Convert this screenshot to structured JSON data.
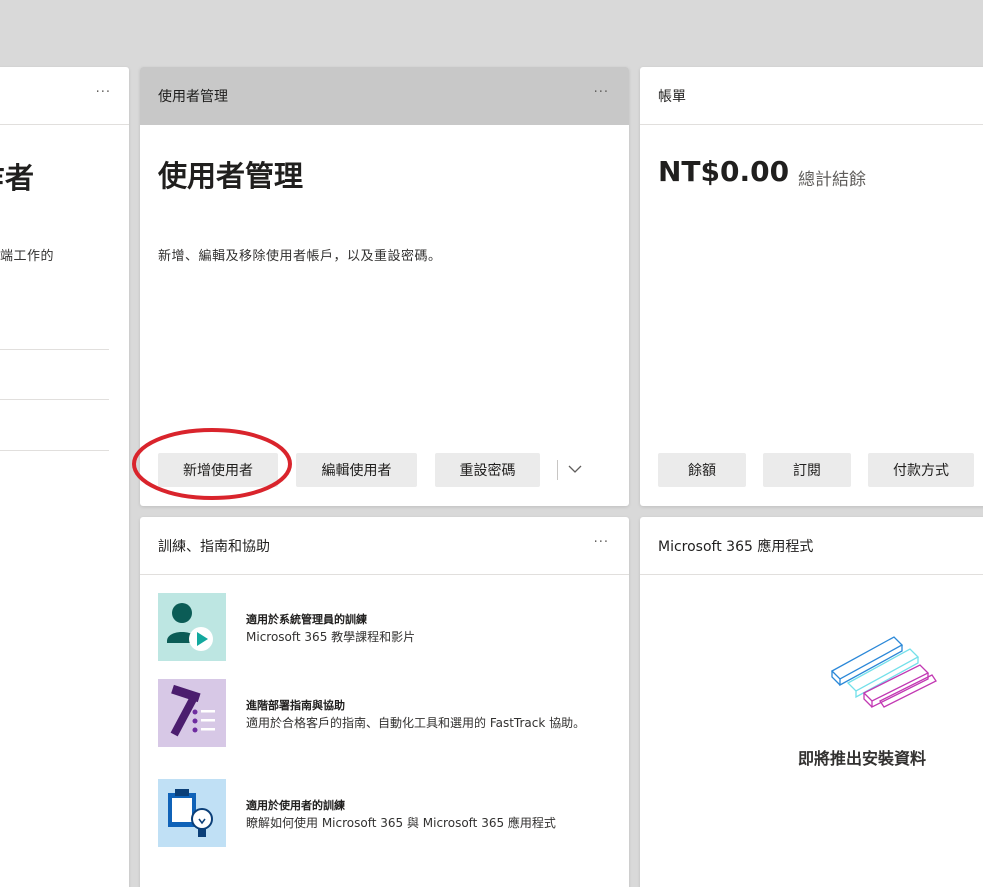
{
  "left_card": {
    "title_fragment": "乍者",
    "desc_fragment": "端工作的"
  },
  "user_mgmt": {
    "header": "使用者管理",
    "title": "使用者管理",
    "description": "新增、編輯及移除使用者帳戶，以及重設密碼。",
    "add_user": "新增使用者",
    "edit_user": "編輯使用者",
    "reset_password": "重設密碼"
  },
  "billing": {
    "header": "帳單",
    "amount": "NT$0.00",
    "amount_label": "總計結餘",
    "balance": "餘額",
    "subscriptions": "訂閱",
    "payment_methods": "付款方式"
  },
  "training": {
    "header": "訓練、指南和協助",
    "items": [
      {
        "title": "適用於系統管理員的訓練",
        "subtitle": "Microsoft 365 教學課程和影片"
      },
      {
        "title": "進階部署指南與協助",
        "subtitle": "適用於合格客戶的指南、自動化工具和選用的 FastTrack 協助。"
      },
      {
        "title": "適用於使用者的訓練",
        "subtitle": "瞭解如何使用 Microsoft 365 與 Microsoft 365 應用程式"
      }
    ]
  },
  "apps": {
    "header": "Microsoft 365 應用程式",
    "coming_soon": "即將推出安裝資料"
  },
  "common": {
    "more": "···"
  },
  "colors": {
    "highlight_circle": "#d9242c",
    "teal_tile": "#bde6e2",
    "purple_tile": "#d7c8e6",
    "blue_tile": "#c0e0f5"
  }
}
